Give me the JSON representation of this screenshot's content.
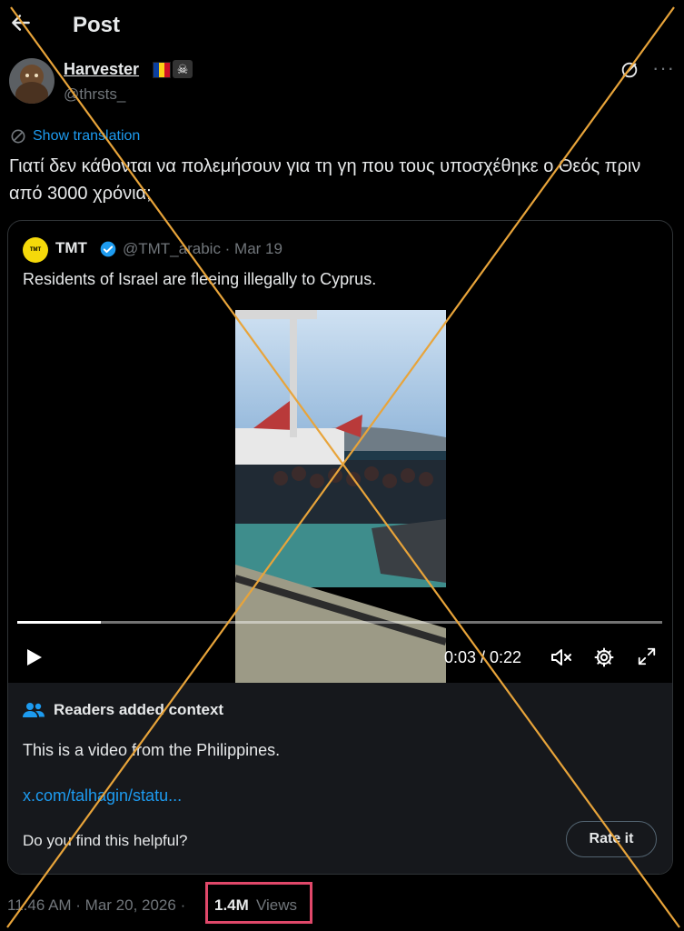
{
  "header": {
    "title": "Post"
  },
  "author": {
    "name": "Harvester",
    "handle": "@thrsts_",
    "flag_colors": [
      "#0b3f9f",
      "#fcd116",
      "#ce1126"
    ],
    "badge_icon": "☠"
  },
  "post": {
    "show_translation": "Show translation",
    "text": "Γιατί δεν κάθονται να πολεμήσουν για τη γη που τους υποσχέθηκε ο Θεός πριν από 3000 χρόνια;"
  },
  "quote": {
    "avatar_text": "TMT",
    "name": "TMT",
    "meta": "@TMT_arabic · Mar 19",
    "text": "Residents of Israel are fleeing illegally to Cyprus."
  },
  "video": {
    "time": "0:03 / 0:22",
    "progress": 0.13
  },
  "context": {
    "title": "Readers added context",
    "body": "This is a video from the Philippines.",
    "link": "x.com/talhagin/statu...",
    "question": "Do you find this helpful?",
    "rate_label": "Rate it"
  },
  "footer": {
    "timestamp": "11:46 AM · Mar 20, 2026 ·",
    "views_count": "1.4M",
    "views_label": "Views"
  },
  "colors": {
    "accent": "#1d9bf0",
    "highlight_box": "#e0486a",
    "overlay_cross": "#e8a43a"
  }
}
